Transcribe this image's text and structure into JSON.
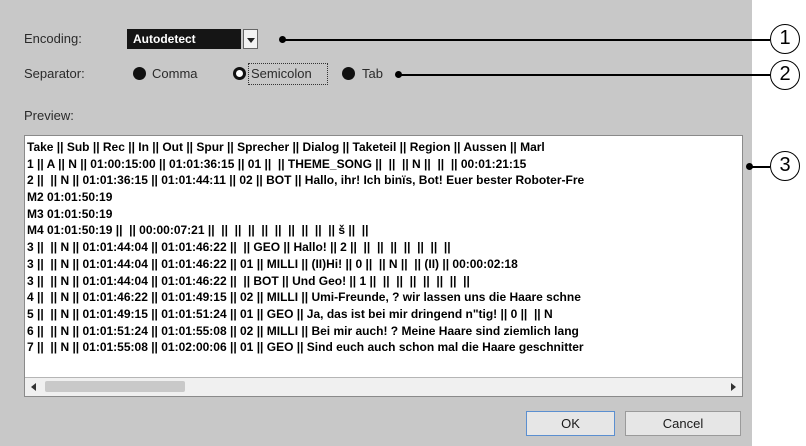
{
  "encoding": {
    "label": "Encoding:",
    "value": "Autodetect"
  },
  "separator": {
    "label": "Separator:",
    "options": [
      {
        "label": "Comma",
        "selected": false
      },
      {
        "label": "Semicolon",
        "selected": true
      },
      {
        "label": "Tab",
        "selected": false
      }
    ]
  },
  "preview": {
    "label": "Preview:",
    "lines": [
      "Take || Sub || Rec || In || Out || Spur || Sprecher || Dialog || Taketeil || Region || Aussen || Marl",
      "1 || A || N || 01:00:15:00 || 01:01:36:15 || 01 ||  || THEME_SONG ||  ||  || N ||  ||  || 00:01:21:15",
      "2 ||  || N || 01:01:36:15 || 01:01:44:11 || 02 || BOT || Hallo, ihr! Ich binïs, Bot! Euer bester Roboter-Fre",
      "M2 01:01:50:19",
      "M3 01:01:50:19",
      "M4 01:01:50:19 ||  || 00:00:07:21 ||  ||  ||  ||  ||  ||  ||  ||  ||  || š ||  ||",
      "3 ||  || N || 01:01:44:04 || 01:01:46:22 ||  || GEO || Hallo! || 2 ||  ||  ||  ||  ||  ||  ||  ||",
      "3 ||  || N || 01:01:44:04 || 01:01:46:22 || 01 || MILLI || (II)Hi! || 0 ||  || N ||  || (II) || 00:00:02:18",
      "3 ||  || N || 01:01:44:04 || 01:01:46:22 ||  || BOT || Und Geo! || 1 ||  ||  ||  ||  ||  ||  ||  ||",
      "4 ||  || N || 01:01:46:22 || 01:01:49:15 || 02 || MILLI || Umi-Freunde, ? wir lassen uns die Haare schne",
      "5 ||  || N || 01:01:49:15 || 01:01:51:24 || 01 || GEO || Ja, das ist bei mir dringend n\"tig! || 0 ||  || N",
      "6 ||  || N || 01:01:51:24 || 01:01:55:08 || 02 || MILLI || Bei mir auch! ? Meine Haare sind ziemlich lang",
      "7 ||  || N || 01:01:55:08 || 01:02:00:06 || 01 || GEO || Sind euch auch schon mal die Haare geschnitter"
    ]
  },
  "buttons": {
    "ok": "OK",
    "cancel": "Cancel"
  },
  "callouts": [
    "1",
    "2",
    "3"
  ],
  "icons": {
    "dropdown": "chevron-down-icon",
    "scroll_left": "arrow-left-icon",
    "scroll_right": "arrow-right-icon"
  }
}
